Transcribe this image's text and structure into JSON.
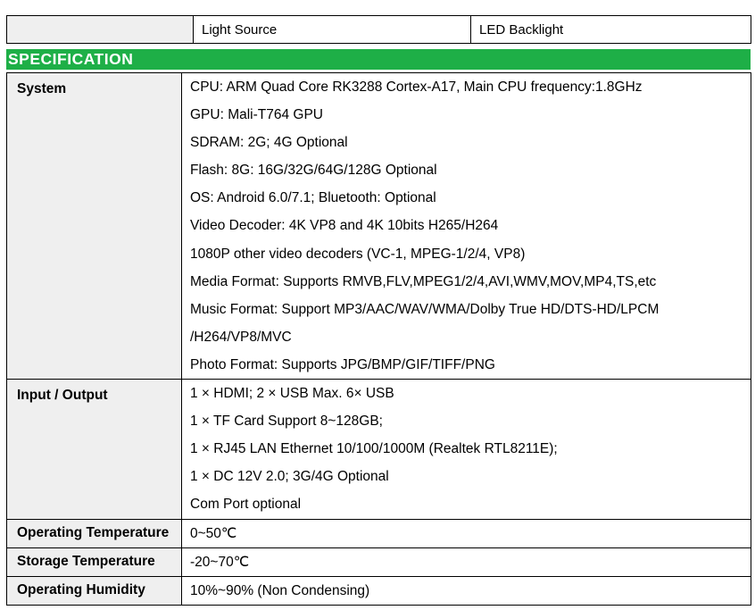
{
  "top_row": {
    "cell1": "",
    "cell2": "Light Source",
    "cell3": "LED Backlight"
  },
  "section_title": "SPECIFICATION",
  "rows": [
    {
      "label": "System",
      "lines": [
        "CPU: ARM Quad Core RK3288 Cortex-A17, Main CPU frequency:1.8GHz",
        "GPU: Mali-T764 GPU",
        "SDRAM: 2G; 4G Optional",
        "Flash: 8G: 16G/32G/64G/128G Optional",
        "OS: Android 6.0/7.1; Bluetooth: Optional",
        "Video Decoder: 4K VP8 and 4K 10bits H265/H264",
        "1080P other video decoders (VC-1, MPEG-1/2/4, VP8)",
        "Media Format: Supports RMVB,FLV,MPEG1/2/4,AVI,WMV,MOV,MP4,TS,etc",
        "Music Format: Support MP3/AAC/WAV/WMA/Dolby True HD/DTS-HD/LPCM",
        "/H264/VP8/MVC",
        "Photo Format: Supports JPG/BMP/GIF/TIFF/PNG"
      ]
    },
    {
      "label": "Input / Output",
      "lines": [
        "1 × HDMI; 2 × USB Max. 6× USB",
        "1 × TF Card Support 8~128GB;",
        "1 × RJ45 LAN Ethernet 10/100/1000M (Realtek RTL8211E);",
        "1 × DC 12V 2.0; 3G/4G Optional",
        "Com Port optional"
      ]
    },
    {
      "label": "Operating Temperature",
      "lines": [
        "0~50℃"
      ]
    },
    {
      "label": "Storage Temperature",
      "lines": [
        "-20~70℃"
      ]
    },
    {
      "label": "Operating Humidity",
      "lines": [
        "10%~90% (Non Condensing)"
      ]
    }
  ]
}
